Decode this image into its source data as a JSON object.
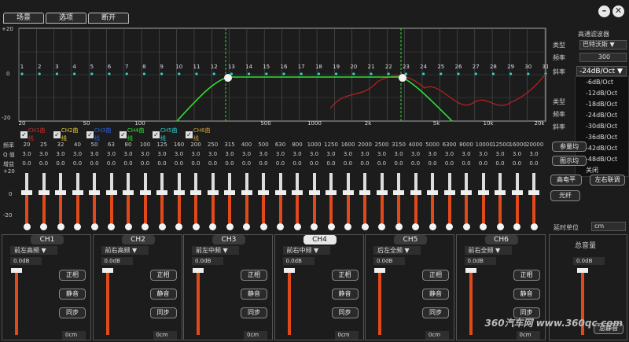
{
  "tabs": [
    "场景",
    "选项",
    "断开"
  ],
  "window": {
    "min": "–",
    "close": "✕"
  },
  "graph": {
    "y_top": "+20",
    "y_mid": "0",
    "y_bot": "-20",
    "band_numbers": [
      "1",
      "2",
      "3",
      "4",
      "5",
      "6",
      "7",
      "8",
      "9",
      "10",
      "11",
      "12",
      "13",
      "14",
      "15",
      "16",
      "17",
      "18",
      "19",
      "20",
      "21",
      "22",
      "23",
      "24",
      "25",
      "26",
      "27",
      "28",
      "29",
      "30",
      "31"
    ],
    "x_ticks": [
      "20",
      "50",
      "100",
      "500",
      "1000",
      "2k",
      "5k",
      "10k",
      "20k"
    ]
  },
  "legend": [
    {
      "label": "CH1曲线",
      "color": "#d02a2a"
    },
    {
      "label": "CH2曲线",
      "color": "#e8d030"
    },
    {
      "label": "CH3曲线",
      "color": "#2a60e0"
    },
    {
      "label": "CH4曲线",
      "color": "#30e030"
    },
    {
      "label": "CH5曲线",
      "color": "#30d0d0"
    },
    {
      "label": "CH6曲线",
      "color": "#d0a040"
    }
  ],
  "side": {
    "title": "高通滤波器",
    "type_label": "类型",
    "type_value": "巴特沃斯",
    "freq_label": "频率",
    "freq_value": "300",
    "slope_label": "斜率",
    "slope_value": "-24dB/Oct",
    "type2_label": "类型",
    "freq2_label": "频率",
    "slope2_label": "斜率"
  },
  "dropdown": [
    "-6dB/Oct",
    "-12dB/Oct",
    "-18dB/Oct",
    "-24dB/Oct",
    "-30dB/Oct",
    "-36dB/Oct",
    "-42dB/Oct",
    "-48dB/Oct",
    "关闭"
  ],
  "eq_rows": {
    "freq_label": "频率",
    "q_label": "Q 值",
    "gain_label": "增益",
    "freqs": [
      "20",
      "25",
      "32",
      "40",
      "50",
      "63",
      "80",
      "100",
      "125",
      "160",
      "200",
      "250",
      "315",
      "400",
      "500",
      "630",
      "800",
      "1000",
      "1250",
      "1600",
      "2000",
      "2500",
      "3150",
      "4000",
      "5000",
      "6300",
      "8000",
      "10000",
      "12500",
      "16000",
      "20000"
    ],
    "q": "3.0",
    "gain": "0.0"
  },
  "fader_scale": [
    "+20",
    "0",
    "-20"
  ],
  "mid_buttons": {
    "param": "参量均",
    "graph": "图示均",
    "high_level": "高电平",
    "lr_link": "左右联调",
    "fiber": "光纤",
    "delay_unit": "延时单位",
    "delay_value": "cm"
  },
  "channels": [
    {
      "name": "CH1",
      "select": "前左高频"
    },
    {
      "name": "CH2",
      "select": "前右高频"
    },
    {
      "name": "CH3",
      "select": "前左中频"
    },
    {
      "name": "CH4",
      "select": "前右中频"
    },
    {
      "name": "CH5",
      "select": "后左全频"
    },
    {
      "name": "CH6",
      "select": "前右全频"
    }
  ],
  "ch_common": {
    "db": "0.0dB",
    "phase": "正相",
    "mute": "静音",
    "sync": "同步",
    "delay": "0cm"
  },
  "master": {
    "title": "总音量",
    "db": "0.0dB",
    "mute": "总静音"
  },
  "watermark": "360汽车网 www.360qc.com"
}
